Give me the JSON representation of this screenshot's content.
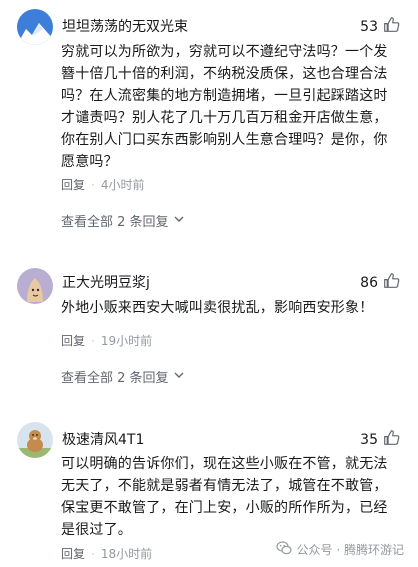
{
  "comments": [
    {
      "username": "坦坦荡荡的无双光束",
      "likes": "53",
      "lines": [
        "穷就可以为所欲为，穷就可以不遵纪守法吗？一个发",
        "簪十倍几十倍的利润，不纳税没质保，这也合理合法",
        "吗？在人流密集的地方制造拥堵，一旦引起踩踏这时",
        "才谴责吗？别人花了几十万几百万租金开店做生意，",
        "你在别人门口买东西影响别人生意合理吗？是你，你",
        "愿意吗？"
      ],
      "reply_label": "回复",
      "time": "4小时前",
      "view_all": "查看全部 2 条回复"
    },
    {
      "username": "正大光明豆浆j",
      "likes": "86",
      "lines": [
        "外地小贩来西安大喊叫卖很扰乱，影响西安形象！"
      ],
      "reply_label": "回复",
      "time": "19小时前",
      "view_all": "查看全部 2 条回复"
    },
    {
      "username": "极速清风4T1",
      "likes": "35",
      "lines": [
        "可以明确的告诉你们，现在这些小贩在不管，就无法",
        "无天了，不能就是弱者有情无法了，城管在不敢管，",
        "保宝更不敢管了，在门上安，小贩的所作所为，已经",
        "是很过了。"
      ],
      "reply_label": "回复",
      "time": "18小时前"
    }
  ],
  "watermark": {
    "text": "公众号 · 腾腾环游记"
  }
}
